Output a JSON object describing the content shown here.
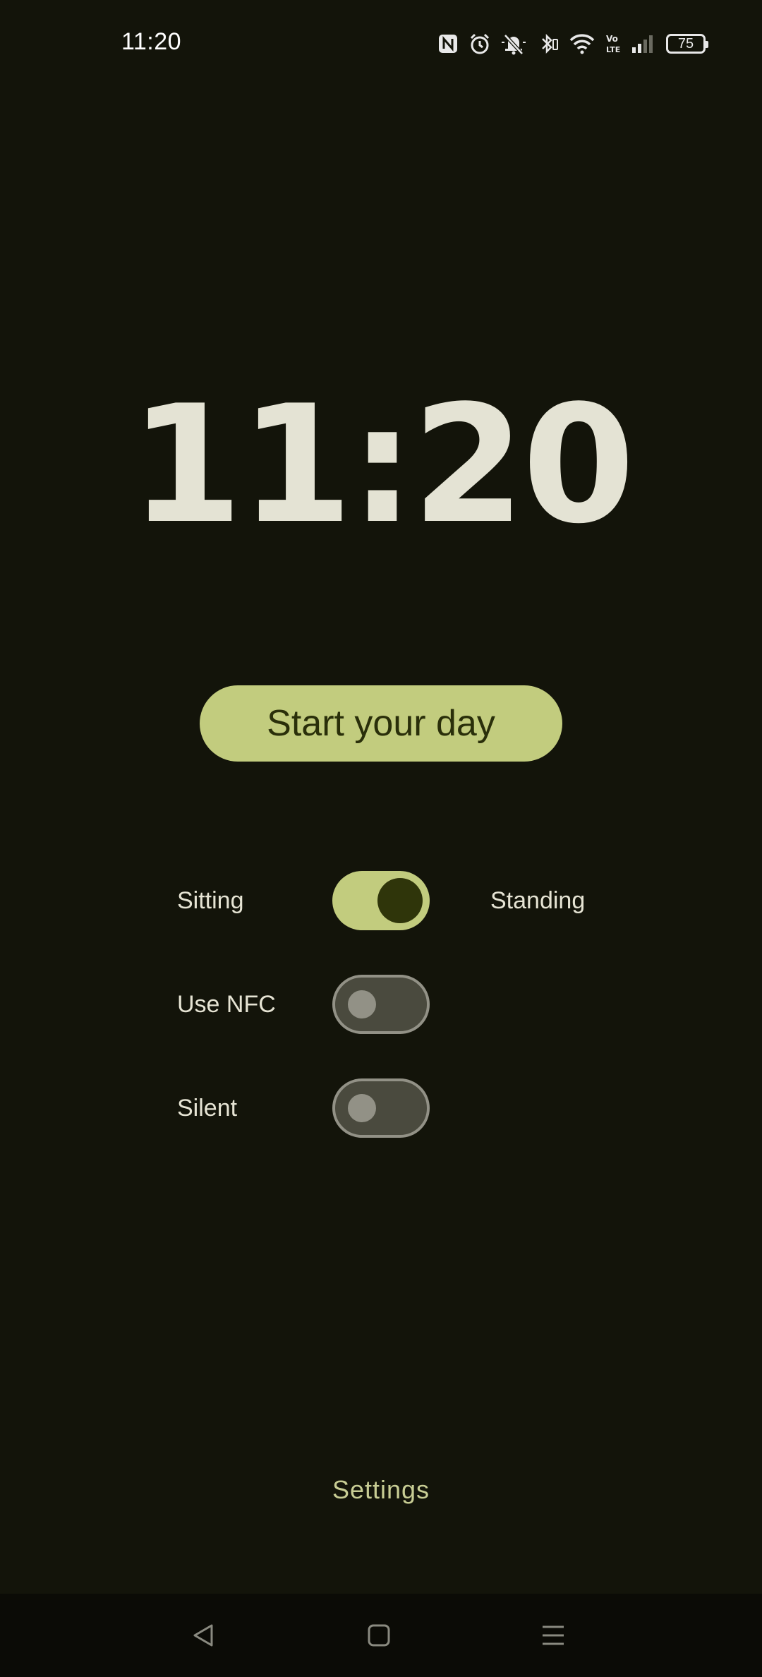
{
  "status_bar": {
    "time": "11:20",
    "battery_level": "75",
    "icons": [
      "nfc-icon",
      "alarm-icon",
      "muted-bell-icon",
      "bluetooth-icon",
      "wifi-icon",
      "volte-icon",
      "signal-icon",
      "battery-icon"
    ]
  },
  "clock": {
    "time": "11:20"
  },
  "main": {
    "start_button_label": "Start your day",
    "position_toggle": {
      "left_label": "Sitting",
      "right_label": "Standing",
      "on": true
    },
    "nfc_toggle": {
      "label": "Use NFC",
      "on": false
    },
    "silent_toggle": {
      "label": "Silent",
      "on": false
    },
    "settings_label": "Settings"
  },
  "colors": {
    "background": "#13140a",
    "accent": "#c2cc7e",
    "accent_dark": "#2f350a",
    "text": "#e5e3d3"
  },
  "nav_bar": {
    "buttons": [
      "back-icon",
      "home-icon",
      "recents-icon"
    ]
  }
}
